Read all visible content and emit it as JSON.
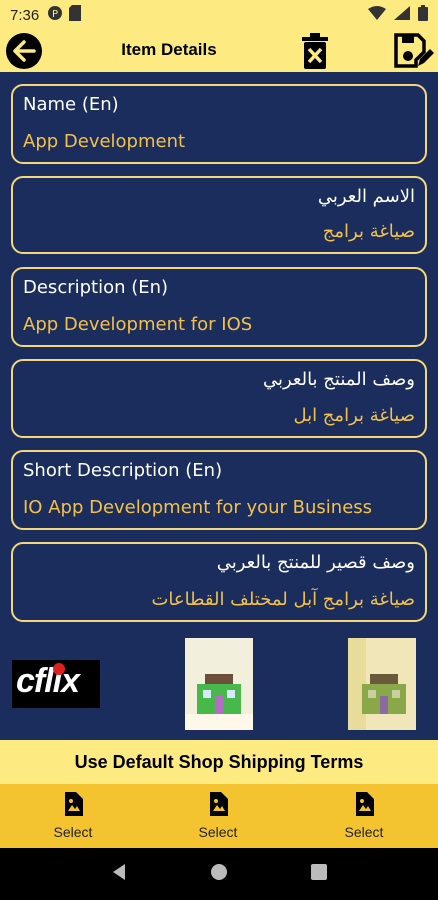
{
  "status": {
    "time": "7:36"
  },
  "header": {
    "title": "Item Details"
  },
  "fields": {
    "name_en": {
      "label": "Name (En)",
      "value": "App Development"
    },
    "name_ar": {
      "label": "الاسم العربي",
      "value": "صياغة  برامج"
    },
    "desc_en": {
      "label": "Description (En)",
      "value": "App Development for IOS"
    },
    "desc_ar": {
      "label": "وصف المنتج بالعربي",
      "value": "صياغة برامج ابل"
    },
    "short_en": {
      "label": "Short Description (En)",
      "value": "IO App Development for your Business"
    },
    "short_ar": {
      "label": "وصف قصير للمنتج بالعربي",
      "value": "صياغة برامج آبل لمختلف القطاعات"
    }
  },
  "images": {
    "logo_text": "cflix"
  },
  "shipping": {
    "label": "Use Default Shop Shipping Terms"
  },
  "select_bar": {
    "items": [
      {
        "label": "Select"
      },
      {
        "label": "Select"
      },
      {
        "label": "Select"
      }
    ]
  },
  "colors": {
    "background": "#1a2d5c",
    "accent_yellow": "#fdeb82",
    "field_border": "#f4d77a",
    "field_value": "#f4c14a",
    "select_bar": "#f4c430"
  }
}
